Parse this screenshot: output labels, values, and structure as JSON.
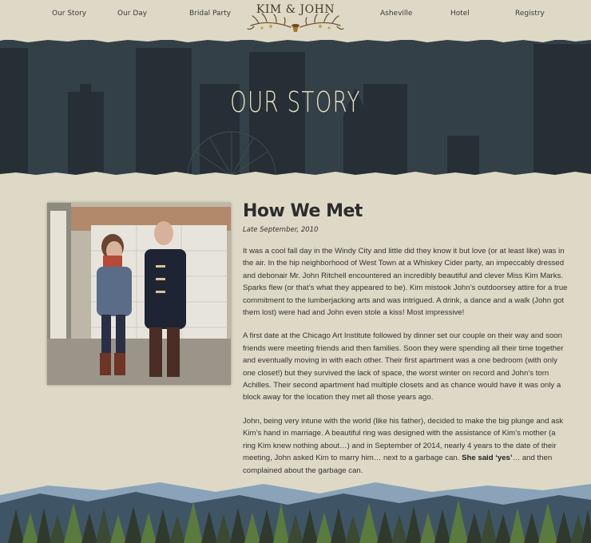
{
  "nav": {
    "left_items": [
      "Our Story",
      "Our Day",
      "Bridal Party"
    ],
    "right_items": [
      "Asheville",
      "Hotel",
      "Registry"
    ],
    "logo_text": "KIM & JOHN"
  },
  "hero": {
    "title": "OUR STORY"
  },
  "article": {
    "heading": "How We Met",
    "date": "Late September, 2010",
    "p1": "It was a cool fall day in the Windy City and little did they know it but love (or at least like) was in the air. In the hip neighborhood of West Town at a Whiskey Cider party, an impeccably dressed and debonair Mr. John Ritchell encountered an incredibly beautiful and clever Miss Kim Marks. Sparks flew (or that’s what they appeared to be). Kim mistook John’s outdoorsey attire for a true commitment to the lumberjacking arts and was intrigued. A drink, a dance and a walk (John got them lost) were had and John even stole a kiss! Most impressive!",
    "p2": "A first date at the Chicago Art Institute followed by dinner set our couple on their way and soon friends were meeting friends and then families. Soon they were spending all their time together and eventually moving in with each other. Their first apartment was a one bedroom (with only one closet!) but they survived the lack of space, the worst winter on record and John’s torn Achilles. Their second apartment had multiple closets and as chance would have it was only a block away for the location they met all those years ago.",
    "p3_a": "John, being very intune with the world (like his father), decided to make the big plunge and ask Kim’s hand in marriage. A beautiful ring was designed with the assistance of Kim’s mother (a ring Kim knew nothing about…) and in September of 2014, nearly 4 years to the date of their meeting, John asked Kim to marry him… next to a garbage can. ",
    "p3_bold": "She said ‘yes’",
    "p3_b": "… and then complained about the garbage can."
  },
  "colors": {
    "background": "#ddd9c6",
    "hero_overlay": "#2f3a40",
    "hero_title": "#ece3c4",
    "mountain_far": "#8aa3b8",
    "mountain_near": "#3f5566",
    "tree_dark": "#2f3a2c",
    "tree_green": "#5a7a3e"
  },
  "icons": {
    "logo_ornament": "antler-branch-icon"
  }
}
